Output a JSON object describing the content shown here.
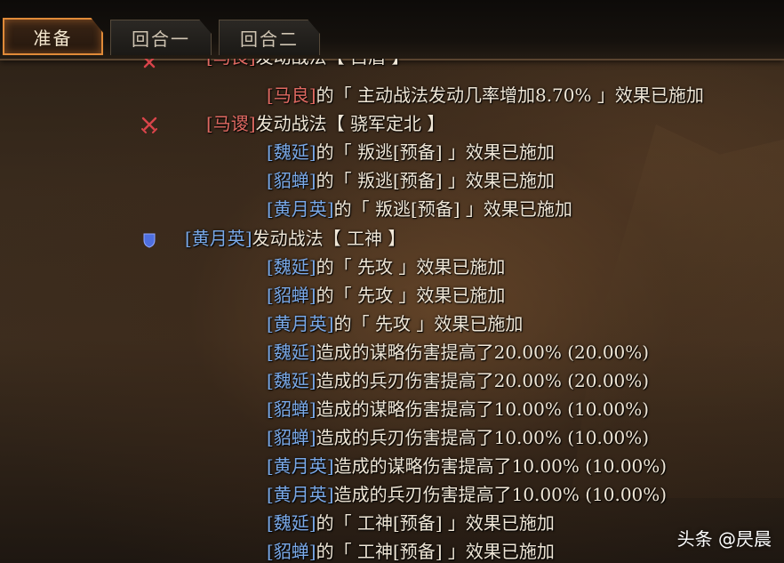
{
  "tabs": [
    {
      "label": "准备",
      "active": true
    },
    {
      "label": "回合一",
      "active": false
    },
    {
      "label": "回合二",
      "active": false
    }
  ],
  "log": [
    {
      "parts": [
        "[马良]",
        "发动战法【 白眉 】"
      ]
    },
    {
      "parts": [
        "[马良]",
        "的「 主动战法发动几率增加8.70% 」效果已施加"
      ]
    },
    {
      "parts": [
        "[马谡]",
        "发动战法【 骁军定北 】"
      ]
    },
    {
      "parts": [
        "[魏延]",
        "的「 叛逃[预备] 」效果已施加"
      ]
    },
    {
      "parts": [
        "[貂蝉]",
        "的「 叛逃[预备] 」效果已施加"
      ]
    },
    {
      "parts": [
        "[黄月英]",
        "的「 叛逃[预备] 」效果已施加"
      ]
    },
    {
      "parts": [
        "[黄月英]",
        "发动战法【 工神 】"
      ]
    },
    {
      "parts": [
        "[魏延]",
        "的「 先攻 」效果已施加"
      ]
    },
    {
      "parts": [
        "[貂蝉]",
        "的「 先攻 」效果已施加"
      ]
    },
    {
      "parts": [
        "[黄月英]",
        "的「 先攻 」效果已施加"
      ]
    },
    {
      "parts": [
        "[魏延]",
        "造成的谋略伤害提高了20.00% (20.00%)"
      ]
    },
    {
      "parts": [
        "[魏延]",
        "造成的兵刃伤害提高了20.00% (20.00%)"
      ]
    },
    {
      "parts": [
        "[貂蝉]",
        "造成的谋略伤害提高了10.00% (10.00%)"
      ]
    },
    {
      "parts": [
        "[貂蝉]",
        "造成的兵刃伤害提高了10.00% (10.00%)"
      ]
    },
    {
      "parts": [
        "[黄月英]",
        "造成的谋略伤害提高了10.00% (10.00%)"
      ]
    },
    {
      "parts": [
        "[黄月英]",
        "造成的兵刃伤害提高了10.00% (10.00%)"
      ]
    },
    {
      "parts": [
        "[魏延]",
        "的「 工神[预备] 」效果已施加"
      ]
    },
    {
      "parts": [
        "[貂蝉]",
        "的「 工神[预备] 」效果已施加"
      ]
    }
  ],
  "colors": {
    "red_team": "#e06a62",
    "blue_team": "#7aa9e8",
    "tab_active_border": "#e08a38"
  },
  "icons": {
    "red_side": "crossed-swords-icon",
    "blue_side": "shield-icon"
  },
  "watermark": "头条 @昃晨"
}
